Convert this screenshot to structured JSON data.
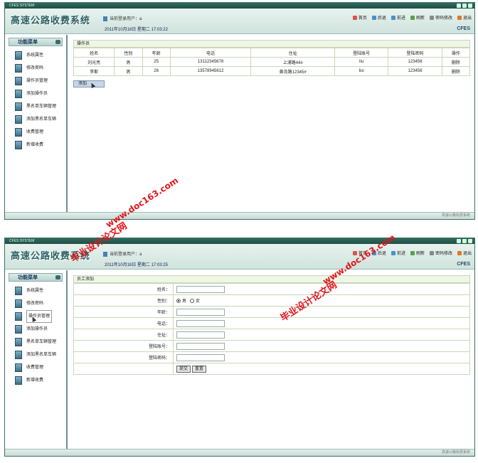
{
  "app": {
    "window_title": "CFES SYSTEM",
    "logo": "高速公路收费系统",
    "user_label": "当前登录用户：a",
    "date_1": "2011年10月18日 星期二 17:03:22",
    "date_2": "2011年10月18日 星期二 17:03:25",
    "brand": "CFES",
    "status": "高速公路收费系统"
  },
  "toolbar": [
    {
      "name": "home",
      "label": "首页",
      "color": "#d9534f"
    },
    {
      "name": "back",
      "label": "后退",
      "color": "#4a90c8"
    },
    {
      "name": "forward",
      "label": "前进",
      "color": "#4a90c8"
    },
    {
      "name": "refresh",
      "label": "刷新",
      "color": "#5aa04a"
    },
    {
      "name": "change-password",
      "label": "密码修改",
      "color": "#888888"
    },
    {
      "name": "exit",
      "label": "退出",
      "color": "#e0762b"
    }
  ],
  "sidebar": {
    "title": "功能菜单",
    "items": [
      "系统属性",
      "修改密码",
      "操作员管理",
      "添加操作员",
      "黑名单车辆管理",
      "添加黑名单车辆",
      "收费管理",
      "新增收费"
    ]
  },
  "operators": {
    "title": "操作员",
    "columns": [
      "姓名",
      "性别",
      "年龄",
      "电话",
      "住址",
      "登陆账号",
      "登陆密码",
      "操作"
    ],
    "rows": [
      [
        "刘光亮",
        "男",
        "25",
        "13112345678",
        "上浦路44#",
        "liu",
        "123456",
        "删除"
      ],
      [
        "李斯",
        "男",
        "26",
        "13578945612",
        "黄岛路12345#",
        "lisi",
        "123456",
        "删除"
      ]
    ],
    "add_label": "添加"
  },
  "employee_form": {
    "title": "员工添加",
    "name_label": "姓名：",
    "gender_label": "性别：",
    "gender_male": "男",
    "gender_female": "女",
    "age_label": "年龄：",
    "phone_label": "电话：",
    "address_label": "住址：",
    "account_label": "登陆账号：",
    "password_label": "登陆密码：",
    "submit_label": "提交",
    "reset_label": "重置"
  },
  "watermarks": {
    "cn": "毕业设计论文网",
    "url": "www.doc163.com"
  }
}
